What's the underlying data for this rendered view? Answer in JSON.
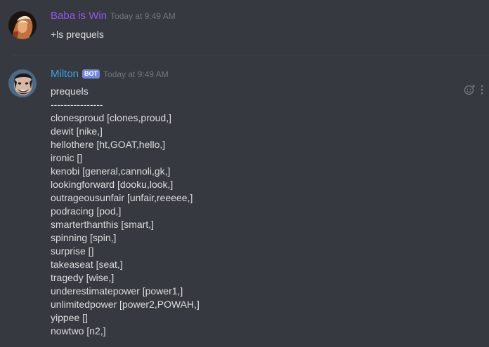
{
  "messages": [
    {
      "username": "Baba is Win",
      "timestamp": "Today at 9:49 AM",
      "username_color": "#8e5aed",
      "content": "+ls prequels"
    },
    {
      "username": "Milton",
      "bot_tag": "BOT",
      "timestamp": "Today at 9:49 AM",
      "username_color": "#3ba3e8",
      "lines": [
        "prequels",
        "----------------",
        "clonesproud [clones,proud,]",
        "dewit [nike,]",
        "hellothere [ht,GOAT,hello,]",
        "ironic []",
        "kenobi [general,cannoli,gk,]",
        "lookingforward [dooku,look,]",
        "outrageousunfair [unfair,reeeee,]",
        "podracing [pod,]",
        "smarterthanthis [smart,]",
        "spinning [spin,]",
        "surprise []",
        "takeaseat [seat,]",
        "tragedy [wise,]",
        "underestimatepower [power1,]",
        "unlimitedpower [power2,POWAH,]",
        "yippee []",
        "nowtwo [n2,]"
      ]
    }
  ],
  "icons": {
    "add_reaction": "add-reaction-icon",
    "more": "more-options-icon"
  },
  "colors": {
    "background": "#36393f",
    "text": "#dcddde",
    "timestamp": "#72767d",
    "bot_tag": "#7289da"
  }
}
